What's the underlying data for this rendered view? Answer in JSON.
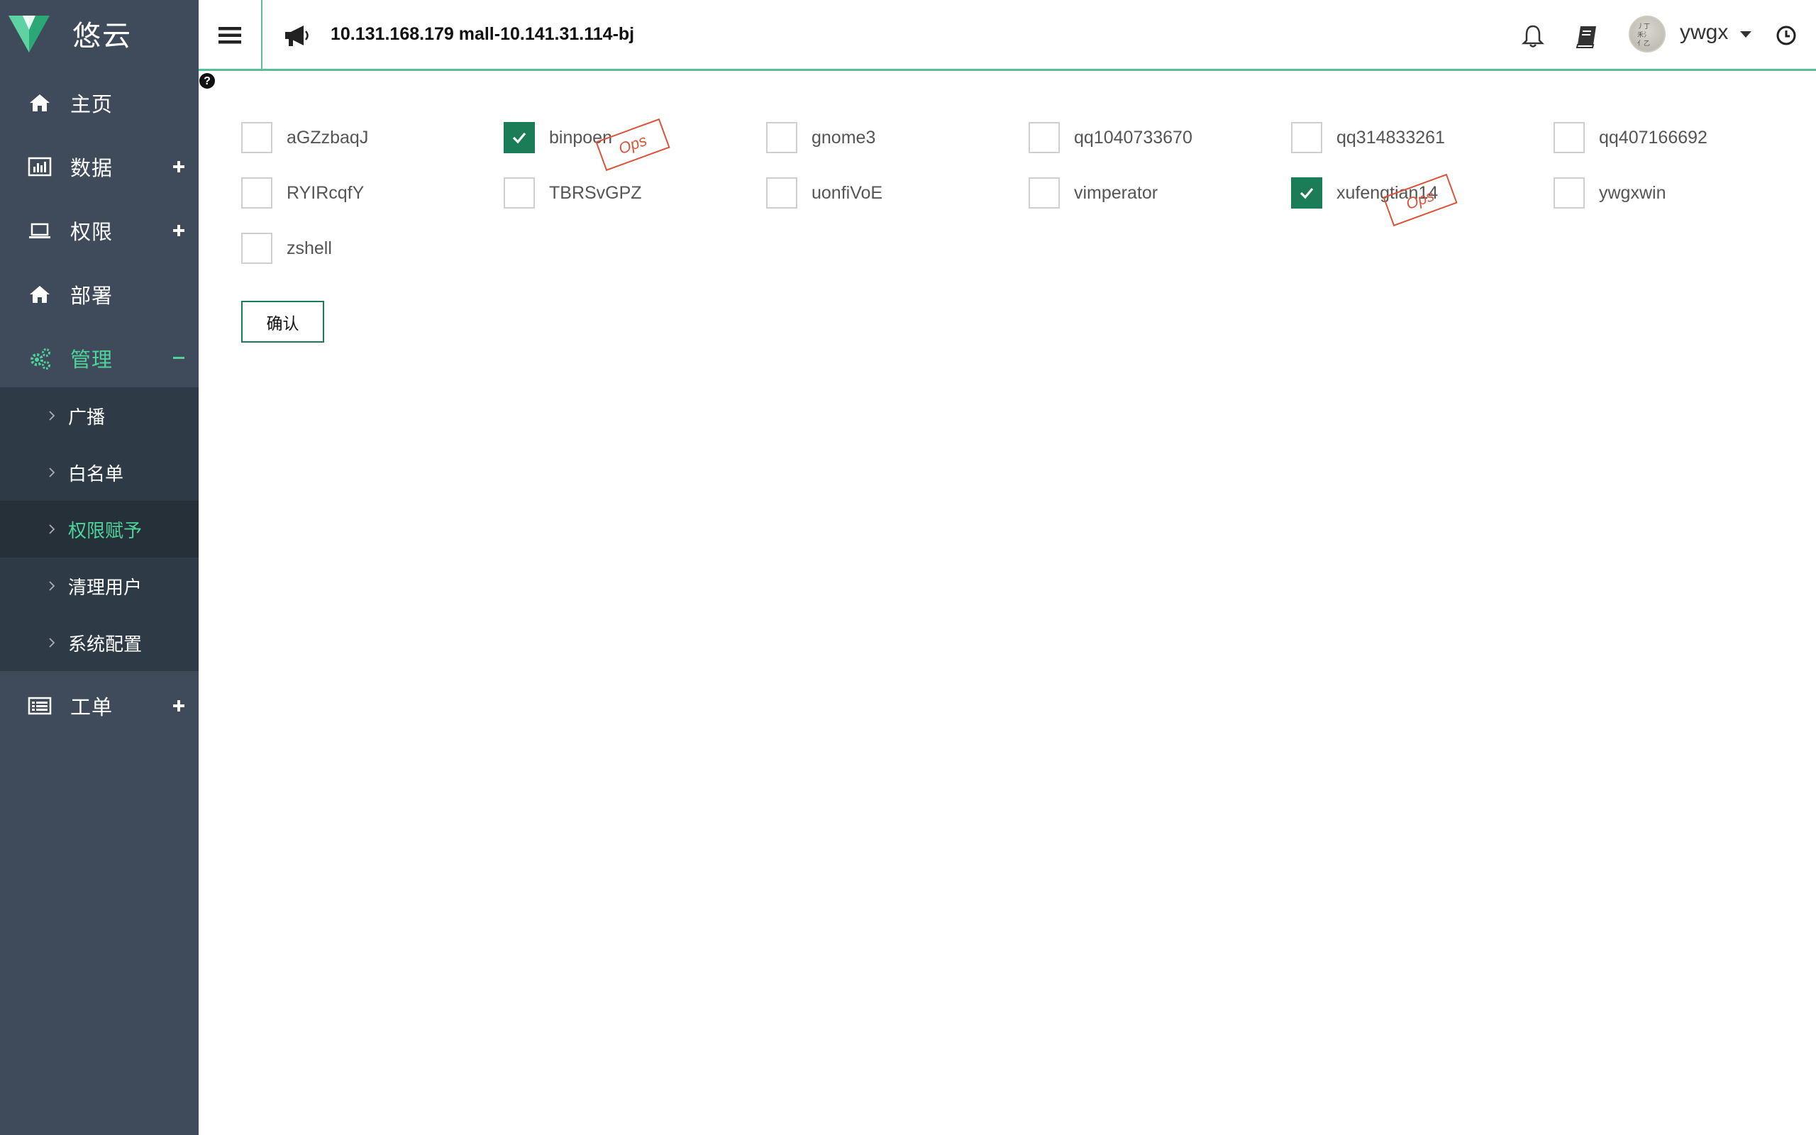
{
  "brand": {
    "name": "悠云"
  },
  "sidebar": {
    "items": [
      {
        "label": "主页",
        "icon": "home-icon",
        "toggle": ""
      },
      {
        "label": "数据",
        "icon": "bar-chart-icon",
        "toggle": "plus"
      },
      {
        "label": "权限",
        "icon": "laptop-icon",
        "toggle": "plus"
      },
      {
        "label": "部署",
        "icon": "home-icon",
        "toggle": ""
      },
      {
        "label": "管理",
        "icon": "gears-icon",
        "toggle": "minus",
        "active": true
      },
      {
        "label": "工单",
        "icon": "list-icon",
        "toggle": "plus"
      }
    ],
    "submenu": [
      {
        "label": "广播"
      },
      {
        "label": "白名单"
      },
      {
        "label": "权限赋予",
        "selected": true
      },
      {
        "label": "清理用户"
      },
      {
        "label": "系统配置"
      }
    ]
  },
  "header": {
    "server_title": "10.131.168.179 mall-10.141.31.114-bj",
    "username": "ywgx"
  },
  "users": [
    {
      "name": "aGZzbaqJ",
      "checked": false
    },
    {
      "name": "binpoen",
      "checked": true,
      "stamp": "Ops"
    },
    {
      "name": "gnome3",
      "checked": false
    },
    {
      "name": "qq1040733670",
      "checked": false
    },
    {
      "name": "qq314833261",
      "checked": false
    },
    {
      "name": "qq407166692",
      "checked": false
    },
    {
      "name": "RYIRcqfY",
      "checked": false
    },
    {
      "name": "TBRSvGPZ",
      "checked": false
    },
    {
      "name": "uonfiVoE",
      "checked": false
    },
    {
      "name": "vimperator",
      "checked": false
    },
    {
      "name": "xufengtian14",
      "checked": true,
      "stamp": "Ops"
    },
    {
      "name": "ywgxwin",
      "checked": false
    },
    {
      "name": "zshell",
      "checked": false
    }
  ],
  "confirm_label": "确认",
  "colors": {
    "sidebar_bg": "#3f4b5b",
    "submenu_bg": "#2f3a47",
    "accent": "#4ed39a",
    "checkbox_checked": "#1a7d58",
    "stamp": "#d8553a"
  }
}
